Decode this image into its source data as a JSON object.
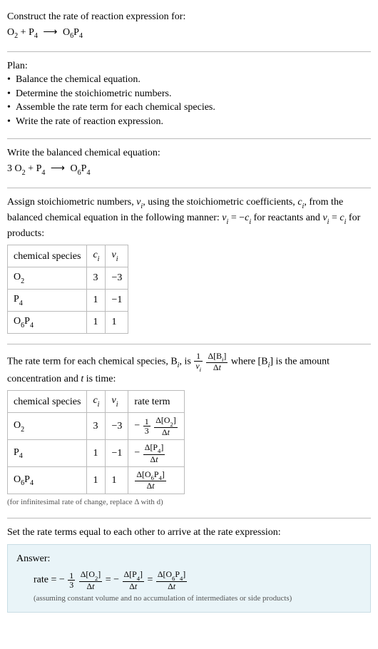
{
  "header": {
    "prompt": "Construct the rate of reaction expression for:",
    "eqn_left_a": "O",
    "eqn_left_a_sub": "2",
    "eqn_plus": " + ",
    "eqn_left_b": "P",
    "eqn_left_b_sub": "4",
    "eqn_arrow": "⟶",
    "eqn_right": "O",
    "eqn_right_sub1": "6",
    "eqn_right_p": "P",
    "eqn_right_sub2": "4"
  },
  "plan": {
    "title": "Plan:",
    "items": [
      "Balance the chemical equation.",
      "Determine the stoichiometric numbers.",
      "Assemble the rate term for each chemical species.",
      "Write the rate of reaction expression."
    ]
  },
  "balanced": {
    "title": "Write the balanced chemical equation:",
    "coef1": "3 ",
    "sp1": "O",
    "sp1_sub": "2",
    "plus": " + ",
    "sp2": "P",
    "sp2_sub": "4",
    "arrow": "⟶",
    "sp3a": "O",
    "sp3a_sub": "6",
    "sp3b": "P",
    "sp3b_sub": "4"
  },
  "stoich": {
    "intro_a": "Assign stoichiometric numbers, ",
    "nu": "ν",
    "i": "i",
    "intro_b": ", using the stoichiometric coefficients, ",
    "c": "c",
    "intro_c": ", from the balanced chemical equation in the following manner: ",
    "rel1_a": "ν",
    "rel1_b": " = −",
    "rel1_c": "c",
    "rel1_d": " for reactants and ",
    "rel2_a": "ν",
    "rel2_b": " = ",
    "rel2_c": "c",
    "rel2_d": " for products:",
    "headers": {
      "sp": "chemical species",
      "c": "c",
      "nu": "ν"
    },
    "rows": [
      {
        "sp": "O",
        "sp_sub": "2",
        "c": "3",
        "nu": "−3"
      },
      {
        "sp": "P",
        "sp_sub": "4",
        "c": "1",
        "nu": "−1"
      },
      {
        "sp_a": "O",
        "sp_a_sub": "6",
        "sp_b": "P",
        "sp_b_sub": "4",
        "c": "1",
        "nu": "1"
      }
    ]
  },
  "rateterm": {
    "intro_a": "The rate term for each chemical species, B",
    "intro_b": ", is ",
    "frac1_num": "1",
    "frac1_den_a": "ν",
    "frac2_num_a": "Δ[B",
    "frac2_num_b": "]",
    "frac2_den": "Δt",
    "intro_c": " where [B",
    "intro_d": "] is the amount concentration and ",
    "t": "t",
    "intro_e": " is time:",
    "headers": {
      "sp": "chemical species",
      "c": "c",
      "nu": "ν",
      "rt": "rate term"
    },
    "rows": [
      {
        "sp": "O",
        "sp_sub": "2",
        "c": "3",
        "nu": "−3",
        "rt_neg": "−",
        "rt_f1_num": "1",
        "rt_f1_den": "3",
        "rt_f2_num_a": "Δ[O",
        "rt_f2_num_sub": "2",
        "rt_f2_num_b": "]",
        "rt_f2_den": "Δt"
      },
      {
        "sp": "P",
        "sp_sub": "4",
        "c": "1",
        "nu": "−1",
        "rt_neg": "−",
        "rt_f2_num_a": "Δ[P",
        "rt_f2_num_sub": "4",
        "rt_f2_num_b": "]",
        "rt_f2_den": "Δt"
      },
      {
        "sp_a": "O",
        "sp_a_sub": "6",
        "sp_b": "P",
        "sp_b_sub": "4",
        "c": "1",
        "nu": "1",
        "rt_f2_num_a": "Δ[O",
        "rt_f2_num_sub": "6",
        "rt_f2_num_mid": "P",
        "rt_f2_num_sub2": "4",
        "rt_f2_num_b": "]",
        "rt_f2_den": "Δt"
      }
    ],
    "note": "(for infinitesimal rate of change, replace Δ with d)"
  },
  "final": {
    "title": "Set the rate terms equal to each other to arrive at the rate expression:"
  },
  "answer": {
    "title": "Answer:",
    "rate_label": "rate = ",
    "neg": "−",
    "f1_num": "1",
    "f1_den": "3",
    "fO_num_a": "Δ[O",
    "fO_sub": "2",
    "fO_num_b": "]",
    "fO_den": "Δt",
    "eq": " = ",
    "fP_num_a": "Δ[P",
    "fP_sub": "4",
    "fP_num_b": "]",
    "fP_den": "Δt",
    "fOP_num_a": "Δ[O",
    "fOP_sub1": "6",
    "fOP_mid": "P",
    "fOP_sub2": "4",
    "fOP_num_b": "]",
    "fOP_den": "Δt",
    "note": "(assuming constant volume and no accumulation of intermediates or side products)"
  }
}
